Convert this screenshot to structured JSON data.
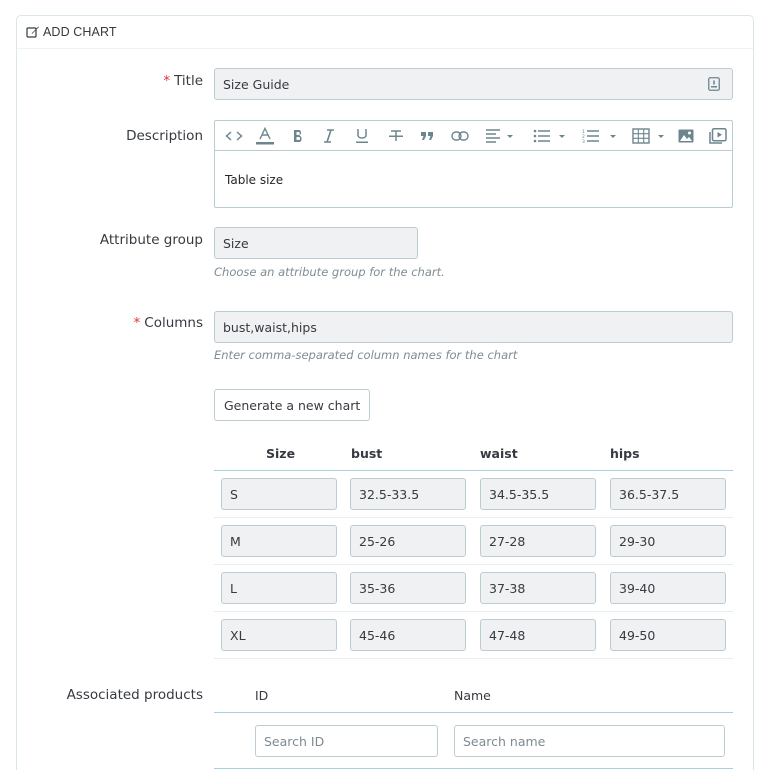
{
  "panel": {
    "title": "ADD CHART"
  },
  "form": {
    "title": {
      "label": "Title",
      "value": "Size Guide"
    },
    "description": {
      "label": "Description",
      "content": "Table size",
      "toolbar": [
        "code-view",
        "font-color",
        "bold",
        "italic",
        "underline",
        "strikethrough",
        "blockquote",
        "link",
        "align",
        "unordered-list",
        "ordered-list",
        "table",
        "image",
        "video"
      ]
    },
    "attribute_group": {
      "label": "Attribute group",
      "value": "Size",
      "hint": "Choose an attribute group for the chart."
    },
    "columns": {
      "label": "Columns",
      "value": "bust,waist,hips",
      "hint": "Enter comma-separated column names for the chart"
    },
    "generate_button": "Generate a new chart"
  },
  "size_table": {
    "headers": [
      "Size",
      "bust",
      "waist",
      "hips"
    ],
    "rows": [
      [
        "S",
        "32.5-33.5",
        "34.5-35.5",
        "36.5-37.5"
      ],
      [
        "M",
        "25-26",
        "27-28",
        "29-30"
      ],
      [
        "L",
        "35-36",
        "37-38",
        "39-40"
      ],
      [
        "XL",
        "45-46",
        "47-48",
        "49-50"
      ]
    ]
  },
  "associated_products": {
    "label": "Associated products",
    "headers": [
      "ID",
      "Name"
    ],
    "search_id_placeholder": "Search ID",
    "search_name_placeholder": "Search name"
  },
  "colors": {
    "required": "#e3303a",
    "accent_line": "#a6d0dd",
    "input_bg": "#eff1f2",
    "input_border": "#bbcdd2"
  }
}
